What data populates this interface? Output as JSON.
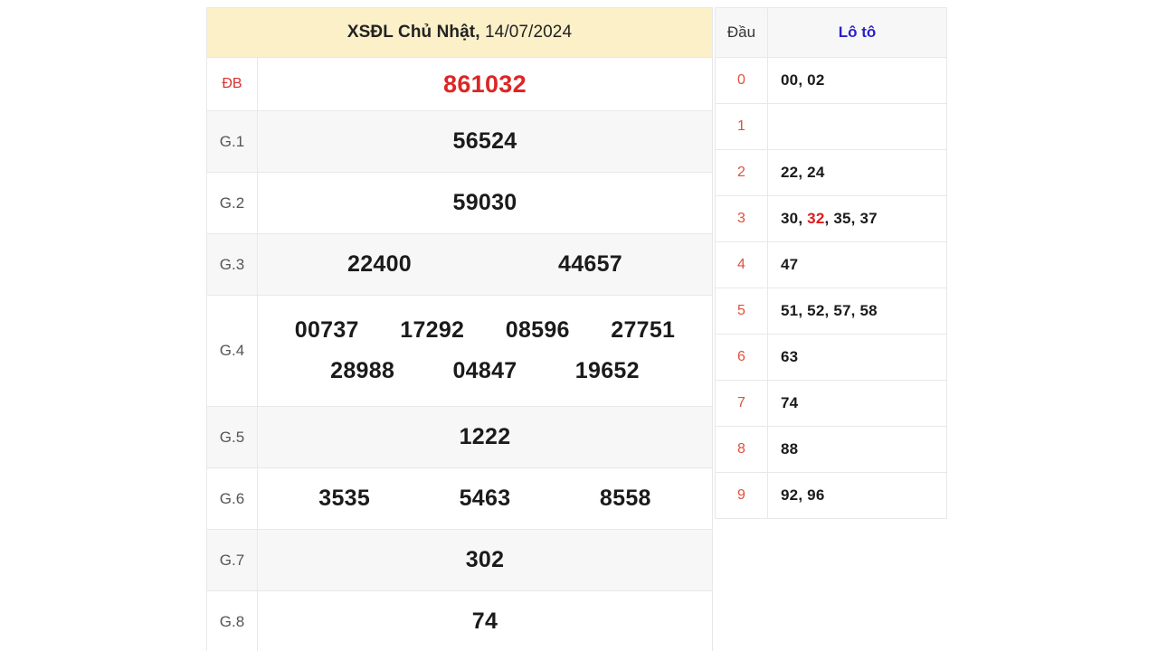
{
  "prize_table": {
    "title_bold": "XSĐL Chủ Nhật,",
    "title_date": "14/07/2024",
    "header_bg": "#fcf0c8",
    "special_color": "#dc2626",
    "rows": [
      {
        "label": "ĐB",
        "numbers": [
          "861032"
        ]
      },
      {
        "label": "G.1",
        "numbers": [
          "56524"
        ]
      },
      {
        "label": "G.2",
        "numbers": [
          "59030"
        ]
      },
      {
        "label": "G.3",
        "numbers": [
          "22400",
          "44657"
        ]
      },
      {
        "label": "G.4",
        "numbers": [
          "00737",
          "17292",
          "08596",
          "27751",
          "28988",
          "04847",
          "19652"
        ]
      },
      {
        "label": "G.5",
        "numbers": [
          "1222"
        ]
      },
      {
        "label": "G.6",
        "numbers": [
          "3535",
          "5463",
          "8558"
        ]
      },
      {
        "label": "G.7",
        "numbers": [
          "302"
        ]
      },
      {
        "label": "G.8",
        "numbers": [
          "74"
        ]
      }
    ]
  },
  "loto_table": {
    "header": {
      "dau": "Đầu",
      "loto": "Lô tô",
      "loto_color": "#2a1fc8"
    },
    "dau_color": "#e0503a",
    "highlight_color": "#e01b1b",
    "rows": [
      {
        "dau": "0",
        "values": "00, 02"
      },
      {
        "dau": "1",
        "values": ""
      },
      {
        "dau": "2",
        "values": "22, 24"
      },
      {
        "dau": "3",
        "values": "30, 32, 35, 37",
        "highlight": "32"
      },
      {
        "dau": "4",
        "values": "47"
      },
      {
        "dau": "5",
        "values": "51, 52, 57, 58"
      },
      {
        "dau": "6",
        "values": "63"
      },
      {
        "dau": "7",
        "values": "74"
      },
      {
        "dau": "8",
        "values": "88"
      },
      {
        "dau": "9",
        "values": "92, 96"
      }
    ]
  }
}
